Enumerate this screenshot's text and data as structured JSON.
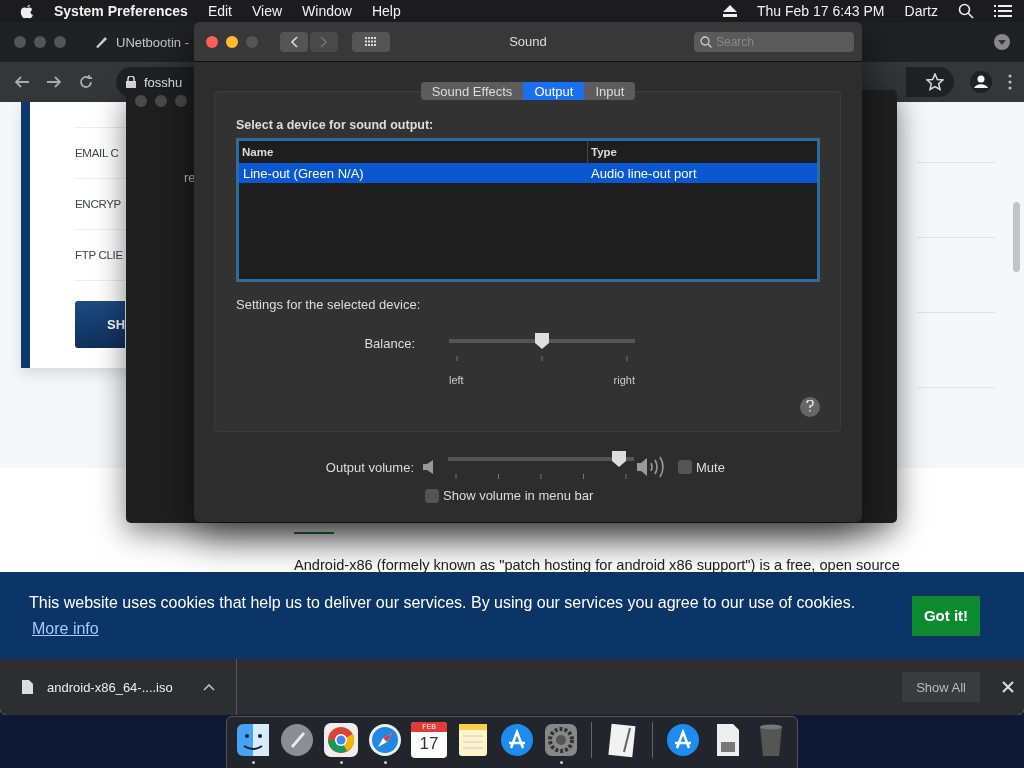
{
  "menubar": {
    "app": "System Preferences",
    "menus": [
      "Edit",
      "View",
      "Window",
      "Help"
    ],
    "clock": "Thu Feb 17  6:43 PM",
    "user": "Dartz"
  },
  "browser": {
    "tab_title": "UNetbootin - ",
    "address": "fosshu",
    "sidebar_items": [
      "EMAIL C",
      "ENCRYP",
      "FTP CLIE"
    ],
    "sidebar_button": "SH",
    "paragraph": "Android-x86 (formely known as \"patch hosting for android x86 support\") is a free, open source",
    "cookie_banner": {
      "message": "This website uses cookies that help us to deliver our services. By using our services you agree to our use of cookies.",
      "link": "More info",
      "button": "Got it!"
    },
    "download": {
      "file": "android-x86_64-....iso",
      "show_all": "Show All"
    }
  },
  "background_window": {
    "text": "re"
  },
  "sound_window": {
    "title": "Sound",
    "search": {
      "placeholder": "Search"
    },
    "tabs": [
      {
        "label": "Sound Effects",
        "selected": false
      },
      {
        "label": "Output",
        "selected": true
      },
      {
        "label": "Input",
        "selected": false
      }
    ],
    "device_prompt": "Select a device for sound output:",
    "table": {
      "columns": [
        "Name",
        "Type"
      ],
      "rows": [
        {
          "cells": [
            "Line-out (Green N/A)",
            "Audio line-out port"
          ],
          "selected": true
        }
      ]
    },
    "settings_label": "Settings for the selected device:",
    "balance": {
      "label": "Balance:",
      "level": 0.5,
      "min_label": "left",
      "max_label": "right"
    },
    "output_volume": {
      "label": "Output volume:",
      "level": 0.96
    },
    "mute": {
      "label": "Mute",
      "checked": false
    },
    "show_in_menu_bar": {
      "label": "Show volume in menu bar",
      "checked": false
    }
  },
  "dock": {
    "items": [
      {
        "kind": "finder",
        "running": true
      },
      {
        "kind": "launchpad",
        "running": false
      },
      {
        "kind": "chrome",
        "running": true
      },
      {
        "kind": "safari",
        "running": true
      },
      {
        "kind": "calendar",
        "running": false,
        "month": "FEB",
        "day": "17"
      },
      {
        "kind": "notes",
        "running": false
      },
      {
        "kind": "appstore",
        "running": false
      },
      {
        "kind": "settings",
        "running": true
      },
      {
        "kind": "divider"
      },
      {
        "kind": "textedit",
        "running": false
      },
      {
        "kind": "divider"
      },
      {
        "kind": "appstore",
        "running": false
      },
      {
        "kind": "document",
        "running": false
      },
      {
        "kind": "trash",
        "running": false
      }
    ]
  }
}
